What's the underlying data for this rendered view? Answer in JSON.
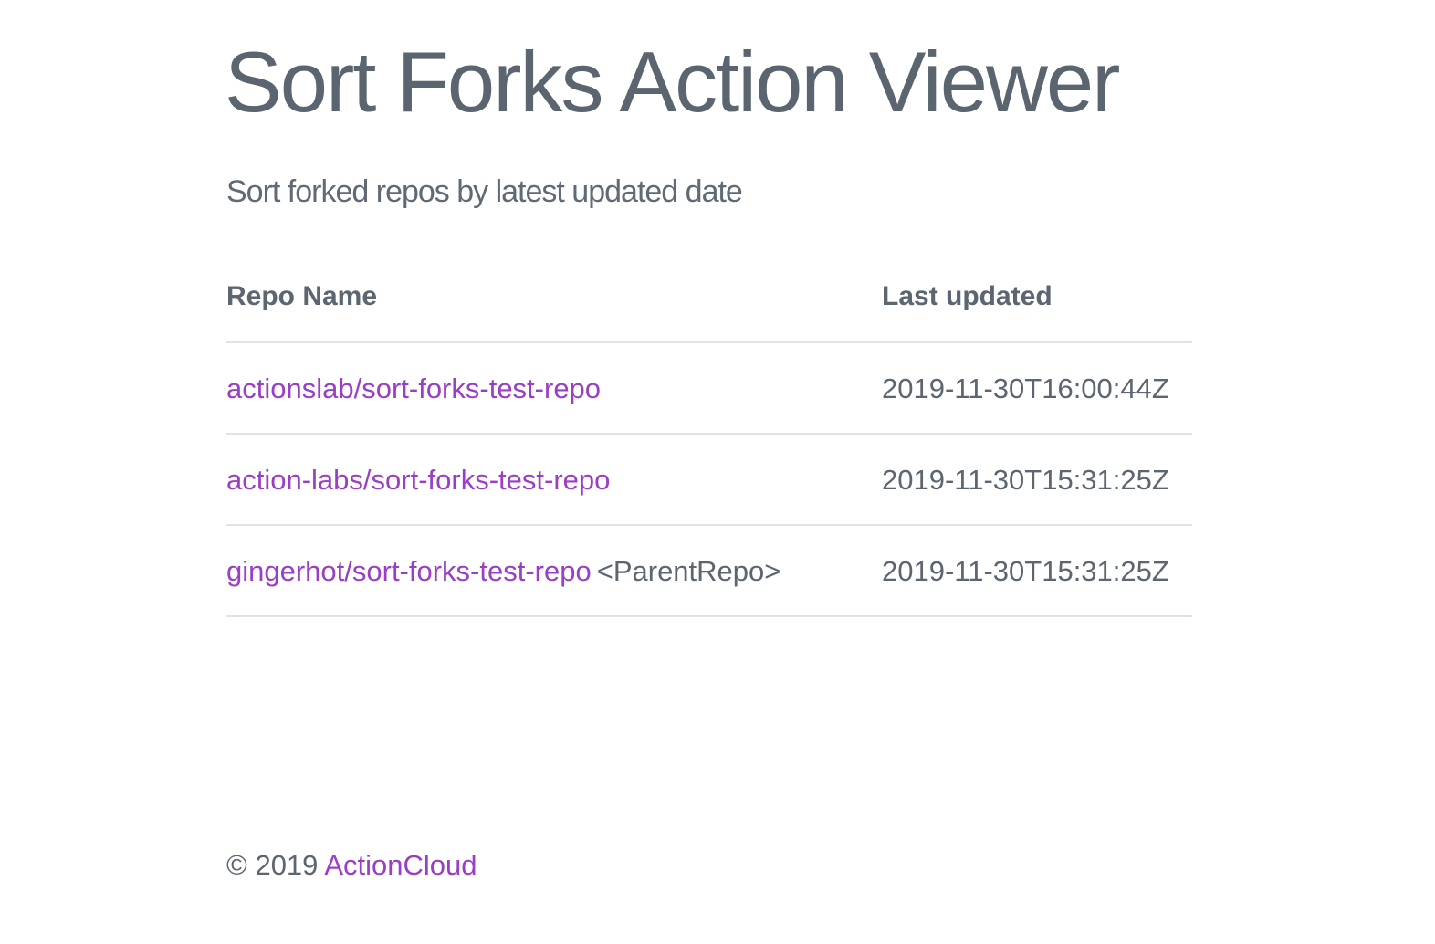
{
  "header": {
    "title": "Sort Forks Action Viewer",
    "subtitle": "Sort forked repos by latest updated date"
  },
  "table": {
    "columns": [
      "Repo Name",
      "Last updated"
    ],
    "rows": [
      {
        "repo": "actionslab/sort-forks-test-repo",
        "tag": "",
        "updated": "2019-11-30T16:00:44Z"
      },
      {
        "repo": "action-labs/sort-forks-test-repo",
        "tag": "",
        "updated": "2019-11-30T15:31:25Z"
      },
      {
        "repo": "gingerhot/sort-forks-test-repo",
        "tag": "<ParentRepo>",
        "updated": "2019-11-30T15:31:25Z"
      }
    ]
  },
  "footer": {
    "copyright": "© 2019",
    "link_label": "ActionCloud"
  },
  "colors": {
    "link": "#9b3ec6",
    "text": "#5c6670",
    "divider": "#e1e4e7"
  }
}
